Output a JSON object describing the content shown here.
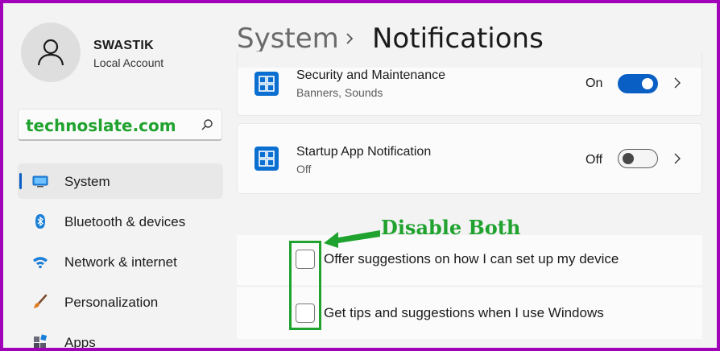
{
  "account": {
    "name": "SWASTIK",
    "type": "Local Account"
  },
  "search": {
    "text": "technoslate.com"
  },
  "nav": [
    {
      "label": "System",
      "icon": "system-icon",
      "active": true
    },
    {
      "label": "Bluetooth & devices",
      "icon": "bluetooth-icon"
    },
    {
      "label": "Network & internet",
      "icon": "wifi-icon"
    },
    {
      "label": "Personalization",
      "icon": "brush-icon"
    },
    {
      "label": "Apps",
      "icon": "apps-icon"
    }
  ],
  "breadcrumb": {
    "parent": "System",
    "current": "Notifications"
  },
  "notifications": [
    {
      "title": "Security and Maintenance",
      "subtitle": "Banners, Sounds",
      "state": "On",
      "enabled": true
    },
    {
      "title": "Startup App Notification",
      "subtitle": "Off",
      "state": "Off",
      "enabled": false
    }
  ],
  "suggestions": [
    {
      "label": "Offer suggestions on how I can set up my device",
      "checked": false
    },
    {
      "label": "Get tips and suggestions when I use Windows",
      "checked": false
    }
  ],
  "annotation": {
    "text": "Disable Both"
  },
  "colors": {
    "accent": "#0a5fc4",
    "annotation": "#1fa22e",
    "border": "#a100b9"
  }
}
